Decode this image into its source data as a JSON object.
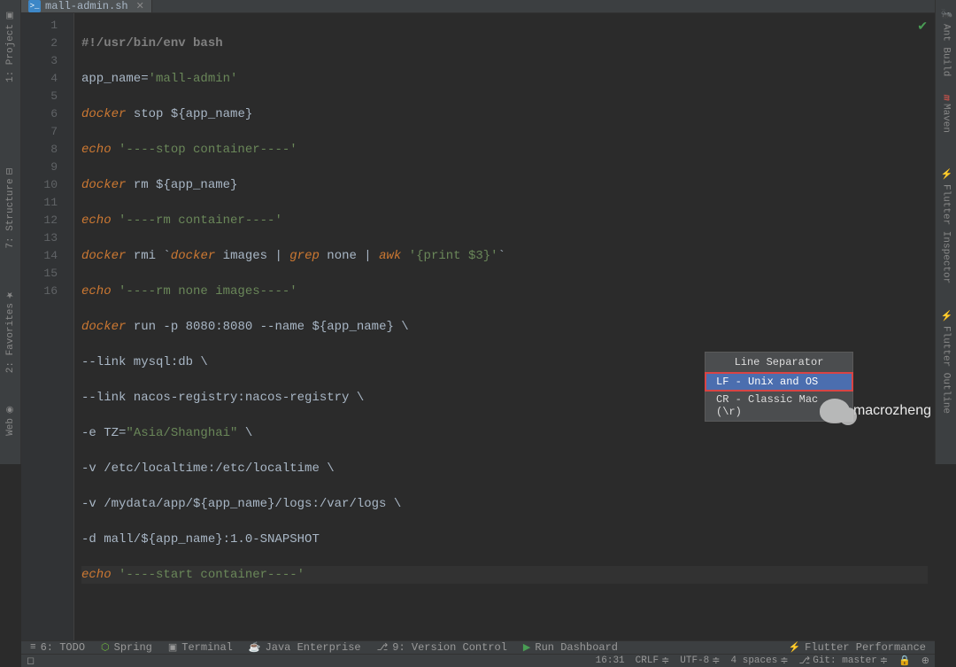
{
  "tab": {
    "filename": "mall-admin.sh"
  },
  "left_sidebar": [
    {
      "label": "1: Project"
    },
    {
      "label": "7: Structure"
    },
    {
      "label": "2: Favorites"
    },
    {
      "label": "Web"
    }
  ],
  "right_sidebar": [
    {
      "label": "Ant Build"
    },
    {
      "label": "Maven"
    },
    {
      "label": "Flutter Inspector"
    },
    {
      "label": "Flutter Outline"
    }
  ],
  "gutter_lines": [
    "1",
    "2",
    "3",
    "4",
    "5",
    "6",
    "7",
    "8",
    "9",
    "10",
    "11",
    "12",
    "13",
    "14",
    "15",
    "16"
  ],
  "code": {
    "l1_shebang": "#!/usr/bin/env bash",
    "l2_txt": "app_name=",
    "l2_str": "'mall-admin'",
    "l3_cmd": "docker",
    "l3_rest": " stop ${app_name}",
    "l4_cmd": "echo",
    "l4_str": " '----stop container----'",
    "l5_cmd": "docker",
    "l5_rest": " rm ${app_name}",
    "l6_cmd": "echo",
    "l6_str": " '----rm container----'",
    "l7_cmd": "docker",
    "l7_a": " rmi `",
    "l7_cmd2": "docker",
    "l7_b": " images | ",
    "l7_cmd3": "grep",
    "l7_c": " none | ",
    "l7_cmd4": "awk",
    "l7_d": " ",
    "l7_str": "'{print $3}'",
    "l7_e": "`",
    "l8_cmd": "echo",
    "l8_str": " '----rm none images----'",
    "l9_cmd": "docker",
    "l9_rest": " run -p 8080:8080 --name ${app_name} \\",
    "l10": "--link mysql:db \\",
    "l11": "--link nacos-registry:nacos-registry \\",
    "l12_a": "-e TZ=",
    "l12_str": "\"Asia/Shanghai\"",
    "l12_b": " \\",
    "l13": "-v /etc/localtime:/etc/localtime \\",
    "l14": "-v /mydata/app/${app_name}/logs:/var/logs \\",
    "l15": "-d mall/${app_name}:1.0-SNAPSHOT",
    "l16_cmd": "echo",
    "l16_str": " '----start container----'"
  },
  "bottom": {
    "todo": "6: TODO",
    "spring": "Spring",
    "terminal": "Terminal",
    "java_ent": "Java Enterprise",
    "vcs": "9: Version Control",
    "run_dash": "Run Dashboard",
    "flutter_perf": "Flutter Performance"
  },
  "popup": {
    "title": "Line Separator",
    "opt1": "LF - Unix and OS",
    "opt2": "CR - Classic Mac (\\r)"
  },
  "status": {
    "cursor": "16:31",
    "crlf": "CRLF",
    "encoding": "UTF-8",
    "indent": "4 spaces",
    "git": "Git: master"
  },
  "watermark": "macrozheng"
}
